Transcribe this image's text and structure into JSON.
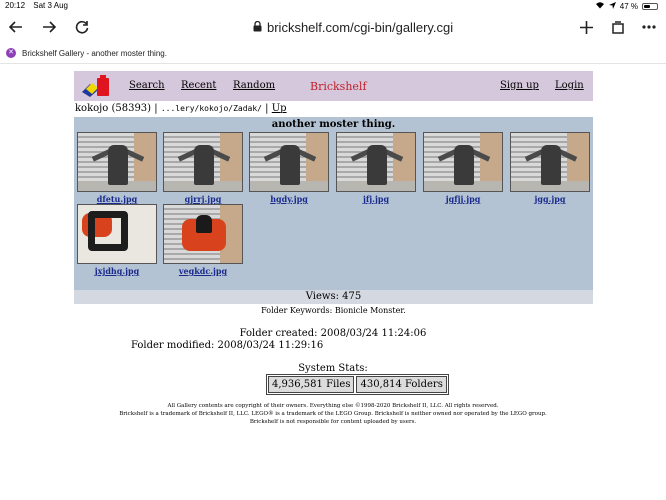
{
  "status_bar": {
    "time": "20:12",
    "date": "Sat 3 Aug",
    "battery": "47 %",
    "battery_level": 0.47
  },
  "browser": {
    "url": "brickshelf.com/cgi-bin/gallery.cgi",
    "tab_title": "Brickshelf Gallery - another moster thing.",
    "icons": [
      "back-arrow-icon",
      "forward-arrow-icon",
      "reload-icon",
      "lock-icon",
      "plus-icon",
      "tabs-icon",
      "more-icon"
    ]
  },
  "nav": {
    "search": "Search",
    "recent": "Recent",
    "random": "Random",
    "brand": "Brickshelf",
    "signup": "Sign up",
    "login": "Login"
  },
  "breadcrumb": {
    "user": "kokojo (58393)",
    "sep1": "|",
    "path": "...lery/kokojo/Zadak/",
    "sep2": "|",
    "up": "Up"
  },
  "gallery": {
    "title": "another moster thing.",
    "thumbs": [
      {
        "caption": "dfetu.jpg"
      },
      {
        "caption": "gjrrj.jpg"
      },
      {
        "caption": "hgdy.jpg"
      },
      {
        "caption": "jfj.jpg"
      },
      {
        "caption": "jgfjj.jpg"
      },
      {
        "caption": "jgg.jpg"
      },
      {
        "caption": "jxjdhg.jpg"
      },
      {
        "caption": "vegkdc.jpg"
      }
    ]
  },
  "views": "Views: 475",
  "keywords": "Folder Keywords: Bionicle Monster.",
  "created": "Folder created: 2008/03/24 11:24:06",
  "modified": "Folder modified: 2008/03/24 11:29:16",
  "system_stats": {
    "title": "System Stats:",
    "files": "4,936,581 Files",
    "folders": "430,814 Folders"
  },
  "footer": {
    "line1": "All Gallery contents are copyright of their owners. Everything else ©1998-2020 Brickshelf II, LLC. All rights reserved.",
    "line2": "Brickshelf is a trademark of Brickshelf II, LLC. LEGO® is a trademark of the LEGO Group. Brickshelf is neither owned nor operated by the LEGO group.",
    "line3": "Brickshelf is not responsible for content uploaded by users."
  },
  "colors": {
    "nav_bg": "#d6c8dc",
    "gallery_bg": "#b4c3d3",
    "brand_red": "#c0212c",
    "link_blue": "#1a2a8c"
  }
}
